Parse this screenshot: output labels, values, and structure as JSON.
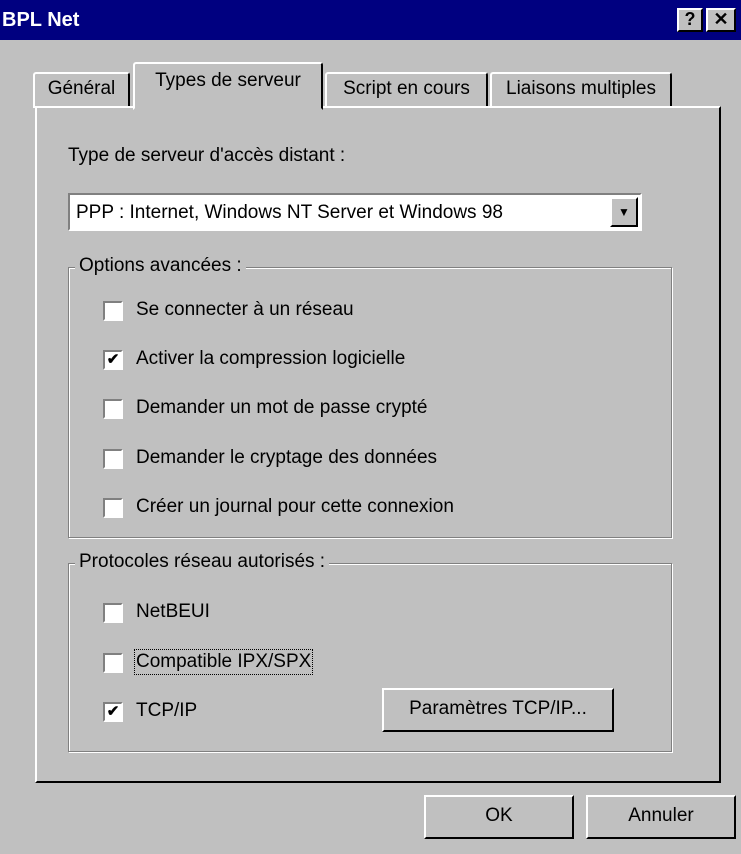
{
  "window": {
    "title": "BPL Net",
    "help_glyph": "?",
    "close_glyph": "✕"
  },
  "tabs": [
    {
      "label": "Général"
    },
    {
      "label": "Types de serveur"
    },
    {
      "label": "Script en cours"
    },
    {
      "label": "Liaisons multiples"
    }
  ],
  "server_type": {
    "label": "Type de serveur d'accès distant :",
    "selected": "PPP : Internet, Windows NT Server et Windows 98",
    "arrow_glyph": "▼"
  },
  "advanced_options": {
    "legend": "Options avancées :",
    "items": [
      {
        "label": "Se connecter à un réseau",
        "checked": false
      },
      {
        "label": "Activer la compression logicielle",
        "checked": true
      },
      {
        "label": "Demander un mot de passe crypté",
        "checked": false
      },
      {
        "label": "Demander le cryptage des données",
        "checked": false
      },
      {
        "label": "Créer un journal pour cette connexion",
        "checked": false
      }
    ]
  },
  "protocols": {
    "legend": "Protocoles réseau autorisés :",
    "items": [
      {
        "label": "NetBEUI",
        "checked": false
      },
      {
        "label": "Compatible IPX/SPX",
        "checked": false
      },
      {
        "label": "TCP/IP",
        "checked": true
      }
    ],
    "settings_button": "Paramètres TCP/IP..."
  },
  "footer": {
    "ok_label": "OK",
    "cancel_label": "Annuler"
  },
  "check_glyph": "✔"
}
